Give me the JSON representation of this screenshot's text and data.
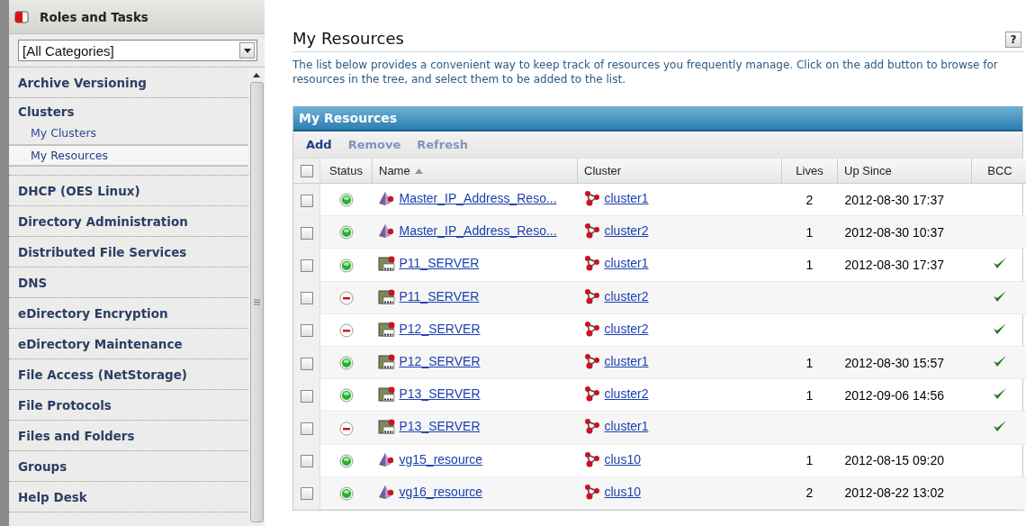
{
  "sidebar": {
    "title": "Roles and Tasks",
    "category_select": {
      "value": "[All Categories]"
    },
    "items": [
      {
        "label": "Archive Versioning"
      },
      {
        "label": "Clusters",
        "expanded": true,
        "children": [
          {
            "label": "My Clusters",
            "selected": false
          },
          {
            "label": "My Resources",
            "selected": true
          }
        ]
      },
      {
        "label": "DHCP (OES Linux)"
      },
      {
        "label": "Directory Administration"
      },
      {
        "label": "Distributed File Services"
      },
      {
        "label": "DNS"
      },
      {
        "label": "eDirectory Encryption"
      },
      {
        "label": "eDirectory Maintenance"
      },
      {
        "label": "File Access (NetStorage)"
      },
      {
        "label": "File Protocols"
      },
      {
        "label": "Files and Folders"
      },
      {
        "label": "Groups"
      },
      {
        "label": "Help Desk"
      }
    ]
  },
  "page": {
    "title": "My Resources",
    "help_button": "?",
    "description": "The list below provides a convenient way to keep track of resources you frequently manage. Click on the add button to browse for resources in the tree, and select them to be added to the list."
  },
  "panel": {
    "title": "My Resources",
    "toolbar": [
      {
        "label": "Add",
        "disabled": false
      },
      {
        "label": "Remove",
        "disabled": true
      },
      {
        "label": "Refresh",
        "disabled": true
      }
    ],
    "table": {
      "select_all": {
        "checked": false
      },
      "columns": [
        {
          "label": "Status",
          "sorted": false
        },
        {
          "label": "Name",
          "sorted": true
        },
        {
          "label": "Cluster",
          "sorted": false
        },
        {
          "label": "Lives",
          "sorted": false
        },
        {
          "label": "Up Since",
          "sorted": false
        },
        {
          "label": "BCC",
          "sorted": false
        }
      ],
      "rows": [
        {
          "checked": false,
          "online": true,
          "kind": "ip",
          "name": "Master_IP_Address_Reso...",
          "cluster": "cluster1",
          "lives": "2",
          "up_since": "2012-08-30 17:37",
          "bcc": false
        },
        {
          "checked": false,
          "online": true,
          "kind": "ip",
          "name": "Master_IP_Address_Reso...",
          "cluster": "cluster2",
          "lives": "1",
          "up_since": "2012-08-30 10:37",
          "bcc": false
        },
        {
          "checked": false,
          "online": true,
          "kind": "server",
          "name": "P11_SERVER",
          "cluster": "cluster1",
          "lives": "1",
          "up_since": "2012-08-30 17:37",
          "bcc": true
        },
        {
          "checked": false,
          "online": false,
          "kind": "server",
          "name": "P11_SERVER",
          "cluster": "cluster2",
          "bcc": true
        },
        {
          "checked": false,
          "online": false,
          "kind": "server",
          "name": "P12_SERVER",
          "cluster": "cluster2",
          "bcc": true
        },
        {
          "checked": false,
          "online": true,
          "kind": "server",
          "name": "P12_SERVER",
          "cluster": "cluster1",
          "lives": "1",
          "up_since": "2012-08-30 15:57",
          "bcc": true
        },
        {
          "checked": false,
          "online": true,
          "kind": "server",
          "name": "P13_SERVER",
          "cluster": "cluster2",
          "lives": "1",
          "up_since": "2012-09-06 14:56",
          "bcc": true
        },
        {
          "checked": false,
          "online": false,
          "kind": "server",
          "name": "P13_SERVER",
          "cluster": "cluster1",
          "bcc": true
        },
        {
          "checked": false,
          "online": true,
          "kind": "ip",
          "name": "vg15_resource",
          "cluster": "clus10",
          "lives": "1",
          "up_since": "2012-08-15  09:20",
          "bcc": false
        },
        {
          "checked": false,
          "online": true,
          "kind": "ip",
          "name": "vg16_resource",
          "cluster": "clus10",
          "lives": "2",
          "up_since": "2012-08-22 13:02",
          "bcc": false
        }
      ]
    }
  }
}
